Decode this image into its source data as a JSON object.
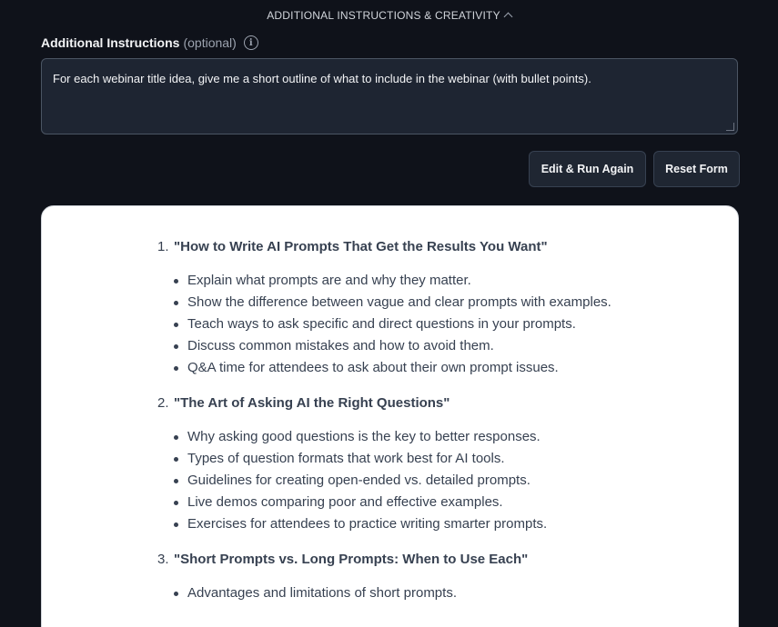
{
  "header": {
    "section_title": "ADDITIONAL INSTRUCTIONS & CREATIVITY"
  },
  "instructions": {
    "label": "Additional Instructions",
    "optional": "(optional)",
    "info_icon": "info-icon",
    "value": "For each webinar title idea, give me a short outline of what to include in the webinar (with bullet points)."
  },
  "actions": {
    "edit_label": "Edit & Run Again",
    "reset_label": "Reset Form"
  },
  "result": {
    "items": [
      {
        "num": "1.",
        "title": "\"How to Write AI Prompts That Get the Results You Want\"",
        "bullets": [
          "Explain what prompts are and why they matter.",
          "Show the difference between vague and clear prompts with examples.",
          "Teach ways to ask specific and direct questions in your prompts.",
          "Discuss common mistakes and how to avoid them.",
          "Q&A time for attendees to ask about their own prompt issues."
        ]
      },
      {
        "num": "2.",
        "title": "\"The Art of Asking AI the Right Questions\"",
        "bullets": [
          "Why asking good questions is the key to better responses.",
          "Types of question formats that work best for AI tools.",
          "Guidelines for creating open-ended vs. detailed prompts.",
          "Live demos comparing poor and effective examples.",
          "Exercises for attendees to practice writing smarter prompts."
        ]
      },
      {
        "num": "3.",
        "title": "\"Short Prompts vs. Long Prompts: When to Use Each\"",
        "bullets": [
          "Advantages and limitations of short prompts."
        ]
      }
    ]
  },
  "colors": {
    "background": "#0f121a",
    "input_bg": "#1e2532",
    "card_bg": "#ffffff",
    "text_dark": "#374151"
  }
}
